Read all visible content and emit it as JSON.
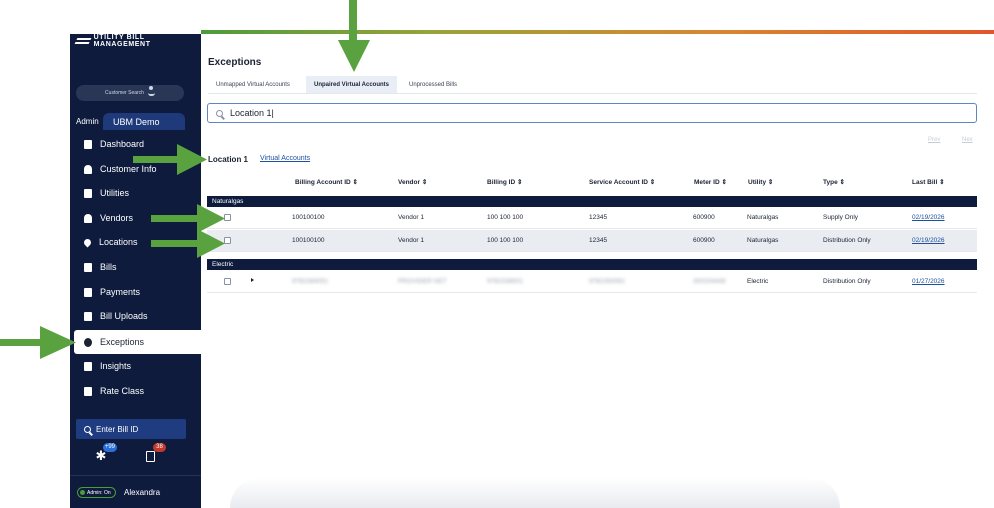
{
  "brand": {
    "name": "UTILITY BILL MANAGEMENT"
  },
  "sidebar": {
    "customer_search_label": "Customer Search",
    "admin_label": "Admin",
    "context_tab": "UBM Demo",
    "items": [
      {
        "label": "Dashboard",
        "icon": "dashboard-icon"
      },
      {
        "label": "Customer Info",
        "icon": "user-icon"
      },
      {
        "label": "Utilities",
        "icon": "utilities-icon"
      },
      {
        "label": "Vendors",
        "icon": "vendors-icon"
      },
      {
        "label": "Locations",
        "icon": "location-pin-icon"
      },
      {
        "label": "Bills",
        "icon": "bills-icon"
      },
      {
        "label": "Payments",
        "icon": "payments-icon"
      },
      {
        "label": "Bill Uploads",
        "icon": "upload-icon"
      },
      {
        "label": "Exceptions",
        "icon": "alert-icon",
        "active": true
      },
      {
        "label": "Insights",
        "icon": "insights-icon"
      },
      {
        "label": "Rate Class",
        "icon": "rate-class-icon"
      }
    ],
    "bill_search_placeholder": "Enter Bill ID",
    "notifications": [
      {
        "icon": "asterisk-icon",
        "badge": "+99",
        "badge_color": "#2b6fd6"
      },
      {
        "icon": "bill-doc-icon",
        "badge": "38",
        "badge_color": "#c0392b"
      }
    ],
    "admin_status": "Admin: On",
    "user_name": "Alexandra"
  },
  "main": {
    "title": "Exceptions",
    "tabs": [
      {
        "label": "Unmapped Virtual Accounts",
        "active": false
      },
      {
        "label": "Unpaired Virtual Accounts",
        "active": true
      },
      {
        "label": "Unprocessed Bills",
        "active": false
      }
    ],
    "search_value": "Location 1|",
    "pager": {
      "prev": "Prev",
      "next": "Nex"
    },
    "location_title": "Location 1",
    "location_link": "Virtual Accounts",
    "columns": [
      "Billing Account ID ⇕",
      "Vendor ⇕",
      "Billing ID ⇕",
      "Service Account ID ⇕",
      "Meter ID ⇕",
      "Utility ⇕",
      "Type ⇕",
      "Last Bill ⇕"
    ],
    "groups": [
      {
        "name": "Naturalgas",
        "rows": [
          {
            "billing_account_id": "100100100",
            "vendor": "Vendor 1",
            "billing_id": "100 100 100",
            "service_account_id": "12345",
            "meter_id": "600900",
            "utility": "Naturalgas",
            "type": "Supply Only",
            "last_bill": "02/19/2026"
          },
          {
            "billing_account_id": "100100100",
            "vendor": "Vendor 1",
            "billing_id": "100 100 100",
            "service_account_id": "12345",
            "meter_id": "600900",
            "utility": "Naturalgas",
            "type": "Distribution Only",
            "last_bill": "02/19/2026"
          }
        ]
      },
      {
        "name": "Electric",
        "rows": [
          {
            "billing_account_id": "9782384051",
            "vendor": "PROVIDER NET",
            "billing_id": "9782338001",
            "service_account_id": "9782350061",
            "meter_id": "300204448",
            "utility": "Electric",
            "type": "Distribution Only",
            "last_bill": "01/27/2026"
          }
        ]
      }
    ]
  },
  "colors": {
    "sidebar_bg": "#0e1b3d",
    "accent": "#1f4fa0",
    "annotation_arrow": "#5aa23f"
  }
}
